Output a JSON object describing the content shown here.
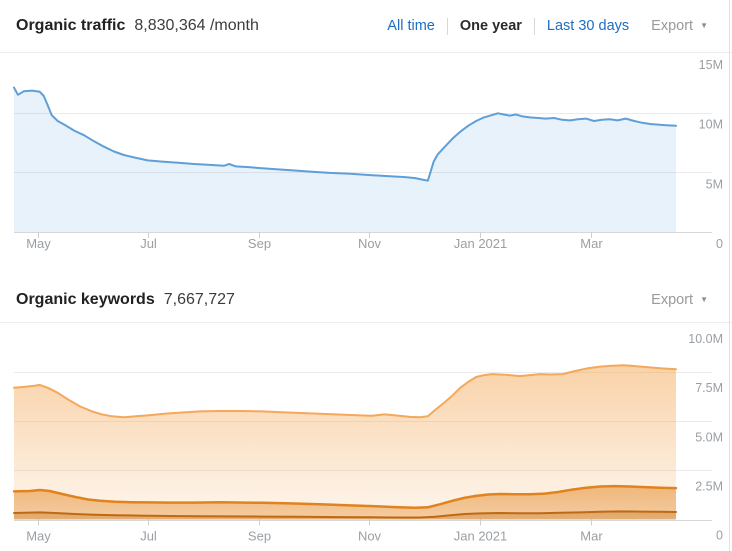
{
  "traffic_section": {
    "title": "Organic traffic",
    "value": "8,830,364 /month",
    "tabs": [
      {
        "label": "All time",
        "active": false
      },
      {
        "label": "One year",
        "active": true
      },
      {
        "label": "Last 30 days",
        "active": false
      }
    ],
    "export_label": "Export",
    "export_caret_icon": "▼"
  },
  "keywords_section": {
    "title": "Organic keywords",
    "value": "7,667,727",
    "export_label": "Export",
    "export_caret_icon": "▼"
  },
  "colors": {
    "link_blue": "#1c6dc5",
    "active_tab": "#2b2b2b",
    "muted_gray": "#9a9a9a",
    "axis_label": "#9a9fa4",
    "gridline": "#ebebeb",
    "baseline": "#d8d8d8",
    "tick": "#cfcfcf",
    "traffic_line": "#5f9fd8",
    "keywords_orange": "#f3a85c",
    "keywords_mid_orange": "#e0831f",
    "keywords_dark_orange": "#bf6a12"
  },
  "chart_data": [
    {
      "id": "traffic",
      "type": "area",
      "title": "Organic traffic",
      "unit": "millions",
      "grid": true,
      "legend": "none",
      "ylim": [
        0,
        15
      ],
      "y_max": 15,
      "xlabel": "",
      "ylabel": "",
      "y_ticks": [
        {
          "label": "15M",
          "value": 15
        },
        {
          "label": "10M",
          "value": 10
        },
        {
          "label": "5M",
          "value": 5
        },
        {
          "label": "0",
          "value": 0
        }
      ],
      "x_ticks": [
        {
          "label": "May",
          "f": 0.036
        },
        {
          "label": "Jul",
          "f": 0.203
        },
        {
          "label": "Sep",
          "f": 0.37
        },
        {
          "label": "Nov",
          "f": 0.537
        },
        {
          "label": "Jan 2021",
          "f": 0.704
        },
        {
          "label": "Mar",
          "f": 0.871
        }
      ],
      "series": [
        {
          "name": "organic-traffic",
          "stroke": "#5f9fd8",
          "stroke_width": 2,
          "fill_top": "rgba(95,159,216,0.14)",
          "fill_bottom": "rgba(95,159,216,0.14)",
          "points": [
            [
              0.0,
              12.1
            ],
            [
              0.006,
              11.5
            ],
            [
              0.015,
              11.8
            ],
            [
              0.027,
              11.85
            ],
            [
              0.039,
              11.75
            ],
            [
              0.045,
              11.4
            ],
            [
              0.051,
              10.6
            ],
            [
              0.057,
              9.8
            ],
            [
              0.066,
              9.3
            ],
            [
              0.079,
              8.9
            ],
            [
              0.091,
              8.5
            ],
            [
              0.106,
              8.1
            ],
            [
              0.121,
              7.6
            ],
            [
              0.136,
              7.15
            ],
            [
              0.151,
              6.75
            ],
            [
              0.166,
              6.45
            ],
            [
              0.181,
              6.25
            ],
            [
              0.202,
              6.0
            ],
            [
              0.224,
              5.9
            ],
            [
              0.248,
              5.8
            ],
            [
              0.272,
              5.7
            ],
            [
              0.296,
              5.62
            ],
            [
              0.317,
              5.55
            ],
            [
              0.325,
              5.7
            ],
            [
              0.335,
              5.5
            ],
            [
              0.357,
              5.42
            ],
            [
              0.375,
              5.35
            ],
            [
              0.399,
              5.25
            ],
            [
              0.424,
              5.15
            ],
            [
              0.45,
              5.05
            ],
            [
              0.477,
              4.95
            ],
            [
              0.508,
              4.88
            ],
            [
              0.541,
              4.75
            ],
            [
              0.568,
              4.68
            ],
            [
              0.591,
              4.6
            ],
            [
              0.606,
              4.52
            ],
            [
              0.616,
              4.4
            ],
            [
              0.625,
              4.3
            ],
            [
              0.628,
              4.8
            ],
            [
              0.634,
              5.9
            ],
            [
              0.64,
              6.5
            ],
            [
              0.65,
              7.1
            ],
            [
              0.662,
              7.8
            ],
            [
              0.674,
              8.4
            ],
            [
              0.686,
              8.9
            ],
            [
              0.698,
              9.3
            ],
            [
              0.71,
              9.6
            ],
            [
              0.722,
              9.8
            ],
            [
              0.731,
              9.95
            ],
            [
              0.74,
              9.85
            ],
            [
              0.749,
              9.75
            ],
            [
              0.758,
              9.85
            ],
            [
              0.767,
              9.7
            ],
            [
              0.779,
              9.6
            ],
            [
              0.792,
              9.55
            ],
            [
              0.803,
              9.5
            ],
            [
              0.816,
              9.55
            ],
            [
              0.828,
              9.4
            ],
            [
              0.84,
              9.35
            ],
            [
              0.852,
              9.45
            ],
            [
              0.864,
              9.5
            ],
            [
              0.876,
              9.3
            ],
            [
              0.888,
              9.4
            ],
            [
              0.9,
              9.45
            ],
            [
              0.912,
              9.35
            ],
            [
              0.924,
              9.5
            ],
            [
              0.937,
              9.3
            ],
            [
              0.949,
              9.15
            ],
            [
              0.961,
              9.05
            ],
            [
              0.973,
              9.0
            ],
            [
              0.985,
              8.95
            ],
            [
              1.0,
              8.9
            ]
          ]
        }
      ]
    },
    {
      "id": "keywords",
      "type": "stacked-area",
      "title": "Organic keywords",
      "unit": "millions",
      "grid": true,
      "legend": "none",
      "ylim": [
        0,
        10
      ],
      "y_max": 10,
      "xlabel": "",
      "ylabel": "",
      "y_ticks": [
        {
          "label": "10.0M",
          "value": 10
        },
        {
          "label": "7.5M",
          "value": 7.5
        },
        {
          "label": "5.0M",
          "value": 5
        },
        {
          "label": "2.5M",
          "value": 2.5
        },
        {
          "label": "0",
          "value": 0
        }
      ],
      "x_ticks": [
        {
          "label": "May",
          "f": 0.036
        },
        {
          "label": "Jul",
          "f": 0.203
        },
        {
          "label": "Sep",
          "f": 0.37
        },
        {
          "label": "Nov",
          "f": 0.537
        },
        {
          "label": "Jan 2021",
          "f": 0.704
        },
        {
          "label": "Mar",
          "f": 0.871
        }
      ],
      "series": [
        {
          "name": "keywords-outer-band",
          "stroke": "#f3a85c",
          "stroke_width": 2,
          "fill_top": "rgba(243,166,82,0.50)",
          "fill_bottom": "rgba(243,166,82,0.10)",
          "points": [
            [
              0.0,
              6.7
            ],
            [
              0.015,
              6.75
            ],
            [
              0.03,
              6.8
            ],
            [
              0.039,
              6.85
            ],
            [
              0.051,
              6.7
            ],
            [
              0.066,
              6.45
            ],
            [
              0.082,
              6.1
            ],
            [
              0.1,
              5.75
            ],
            [
              0.118,
              5.5
            ],
            [
              0.133,
              5.35
            ],
            [
              0.148,
              5.25
            ],
            [
              0.166,
              5.2
            ],
            [
              0.184,
              5.25
            ],
            [
              0.202,
              5.3
            ],
            [
              0.227,
              5.38
            ],
            [
              0.251,
              5.44
            ],
            [
              0.281,
              5.5
            ],
            [
              0.311,
              5.52
            ],
            [
              0.341,
              5.52
            ],
            [
              0.375,
              5.5
            ],
            [
              0.409,
              5.45
            ],
            [
              0.447,
              5.4
            ],
            [
              0.485,
              5.35
            ],
            [
              0.523,
              5.3
            ],
            [
              0.541,
              5.28
            ],
            [
              0.56,
              5.35
            ],
            [
              0.576,
              5.3
            ],
            [
              0.598,
              5.22
            ],
            [
              0.613,
              5.2
            ],
            [
              0.625,
              5.25
            ],
            [
              0.637,
              5.6
            ],
            [
              0.65,
              5.95
            ],
            [
              0.662,
              6.3
            ],
            [
              0.674,
              6.7
            ],
            [
              0.686,
              7.0
            ],
            [
              0.698,
              7.25
            ],
            [
              0.71,
              7.35
            ],
            [
              0.722,
              7.4
            ],
            [
              0.734,
              7.38
            ],
            [
              0.749,
              7.35
            ],
            [
              0.764,
              7.3
            ],
            [
              0.779,
              7.35
            ],
            [
              0.795,
              7.4
            ],
            [
              0.81,
              7.38
            ],
            [
              0.829,
              7.4
            ],
            [
              0.847,
              7.55
            ],
            [
              0.867,
              7.7
            ],
            [
              0.885,
              7.78
            ],
            [
              0.903,
              7.82
            ],
            [
              0.921,
              7.85
            ],
            [
              0.94,
              7.8
            ],
            [
              0.958,
              7.75
            ],
            [
              0.976,
              7.7
            ],
            [
              1.0,
              7.65
            ]
          ]
        },
        {
          "name": "keywords-middle-band",
          "stroke": "#e0831f",
          "stroke_width": 2.5,
          "fill_top": "rgba(229,138,41,0.55)",
          "fill_bottom": "rgba(229,138,41,0.38)",
          "points": [
            [
              0.0,
              1.43
            ],
            [
              0.024,
              1.45
            ],
            [
              0.039,
              1.5
            ],
            [
              0.054,
              1.45
            ],
            [
              0.073,
              1.3
            ],
            [
              0.092,
              1.15
            ],
            [
              0.112,
              1.02
            ],
            [
              0.13,
              0.95
            ],
            [
              0.153,
              0.9
            ],
            [
              0.175,
              0.88
            ],
            [
              0.202,
              0.87
            ],
            [
              0.236,
              0.86
            ],
            [
              0.273,
              0.86
            ],
            [
              0.311,
              0.88
            ],
            [
              0.349,
              0.86
            ],
            [
              0.375,
              0.85
            ],
            [
              0.417,
              0.82
            ],
            [
              0.462,
              0.78
            ],
            [
              0.508,
              0.72
            ],
            [
              0.541,
              0.68
            ],
            [
              0.576,
              0.63
            ],
            [
              0.606,
              0.6
            ],
            [
              0.625,
              0.62
            ],
            [
              0.644,
              0.78
            ],
            [
              0.662,
              0.95
            ],
            [
              0.68,
              1.1
            ],
            [
              0.698,
              1.2
            ],
            [
              0.716,
              1.27
            ],
            [
              0.734,
              1.3
            ],
            [
              0.757,
              1.28
            ],
            [
              0.779,
              1.28
            ],
            [
              0.802,
              1.32
            ],
            [
              0.822,
              1.4
            ],
            [
              0.843,
              1.52
            ],
            [
              0.864,
              1.62
            ],
            [
              0.885,
              1.68
            ],
            [
              0.908,
              1.7
            ],
            [
              0.93,
              1.68
            ],
            [
              0.953,
              1.65
            ],
            [
              0.976,
              1.62
            ],
            [
              1.0,
              1.6
            ]
          ]
        },
        {
          "name": "keywords-inner-band",
          "stroke": "#bf6a12",
          "stroke_width": 2,
          "fill_top": "rgba(191,106,18,0.35)",
          "fill_bottom": "rgba(191,106,18,0.30)",
          "points": [
            [
              0.0,
              0.33
            ],
            [
              0.039,
              0.36
            ],
            [
              0.062,
              0.33
            ],
            [
              0.092,
              0.28
            ],
            [
              0.122,
              0.24
            ],
            [
              0.153,
              0.22
            ],
            [
              0.19,
              0.2
            ],
            [
              0.236,
              0.18
            ],
            [
              0.281,
              0.17
            ],
            [
              0.326,
              0.16
            ],
            [
              0.375,
              0.15
            ],
            [
              0.432,
              0.14
            ],
            [
              0.492,
              0.12
            ],
            [
              0.541,
              0.11
            ],
            [
              0.583,
              0.1
            ],
            [
              0.613,
              0.1
            ],
            [
              0.636,
              0.14
            ],
            [
              0.659,
              0.22
            ],
            [
              0.681,
              0.28
            ],
            [
              0.704,
              0.31
            ],
            [
              0.734,
              0.33
            ],
            [
              0.764,
              0.32
            ],
            [
              0.795,
              0.32
            ],
            [
              0.825,
              0.34
            ],
            [
              0.855,
              0.36
            ],
            [
              0.885,
              0.39
            ],
            [
              0.915,
              0.41
            ],
            [
              0.946,
              0.4
            ],
            [
              0.976,
              0.39
            ],
            [
              1.0,
              0.38
            ]
          ]
        }
      ]
    }
  ]
}
